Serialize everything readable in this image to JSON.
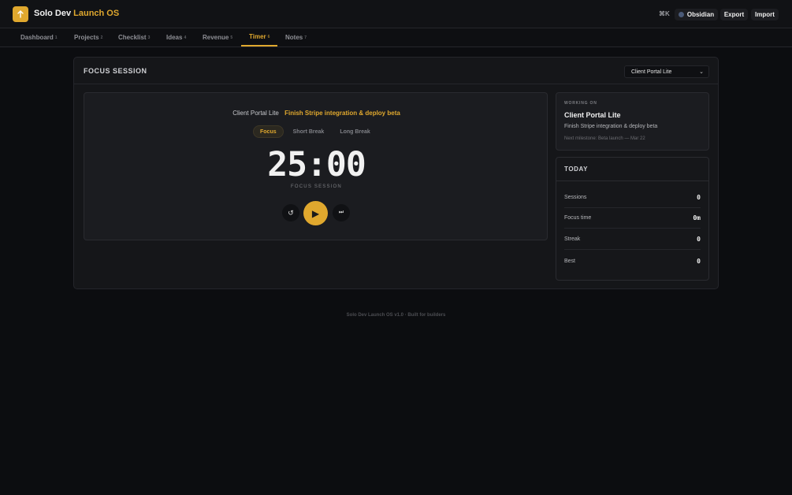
{
  "app": {
    "title_main": "Solo Dev",
    "title_accent": "Launch OS",
    "logo_icon": "arrow-up-icon",
    "accent_color": "#e0a82e"
  },
  "toolbar": {
    "shortcut": "⌘K",
    "obsidian_label": "Obsidian",
    "export_label": "Export",
    "import_label": "Import"
  },
  "nav": {
    "items": [
      {
        "label": "Dashboard",
        "key": "1"
      },
      {
        "label": "Projects",
        "key": "2"
      },
      {
        "label": "Checklist",
        "key": "3"
      },
      {
        "label": "Ideas",
        "key": "4"
      },
      {
        "label": "Revenue",
        "key": "5"
      },
      {
        "label": "Timer",
        "key": "6",
        "active": true
      },
      {
        "label": "Notes",
        "key": "7"
      }
    ]
  },
  "focus": {
    "title": "FOCUS SESSION",
    "project_select": "Client Portal Lite",
    "current_project": "Client Portal Lite",
    "current_task": "Finish Stripe integration & deploy beta",
    "modes": [
      "Focus",
      "Short Break",
      "Long Break"
    ],
    "active_mode": "Focus",
    "time": "25:00",
    "time_label": "FOCUS SESSION",
    "controls": {
      "reset_icon": "↺",
      "play_icon": "▶",
      "skip_icon": "⏭"
    }
  },
  "working_on": {
    "label": "WORKING ON",
    "project": "Client Portal Lite",
    "task": "Finish Stripe integration & deploy beta",
    "milestone": "Next milestone: Beta launch — Mar 22"
  },
  "today": {
    "title": "TODAY",
    "stats": [
      {
        "label": "Sessions",
        "value": "0"
      },
      {
        "label": "Focus time",
        "value": "0m"
      },
      {
        "label": "Streak",
        "value": "0"
      },
      {
        "label": "Best",
        "value": "0"
      }
    ]
  },
  "footer": "Solo Dev Launch OS v1.0 · Built for builders"
}
